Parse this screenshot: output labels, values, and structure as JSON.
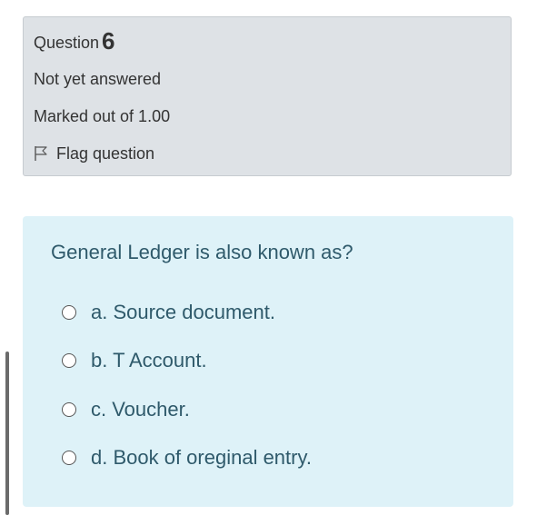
{
  "question_info": {
    "label": "Question",
    "number": "6",
    "state": "Not yet answered",
    "grade": "Marked out of 1.00",
    "flag_label": "Flag question"
  },
  "question": {
    "text": "General Ledger is also known as?",
    "answers": [
      {
        "label": "a. Source document.",
        "selected": false
      },
      {
        "label": "b. T Account.",
        "selected": false
      },
      {
        "label": "c. Voucher.",
        "selected": false
      },
      {
        "label": "d. Book of oreginal entry.",
        "selected": false
      }
    ]
  },
  "colors": {
    "info_background": "#dee2e6",
    "question_background": "#def2f8",
    "question_text": "#2f5a6b"
  }
}
